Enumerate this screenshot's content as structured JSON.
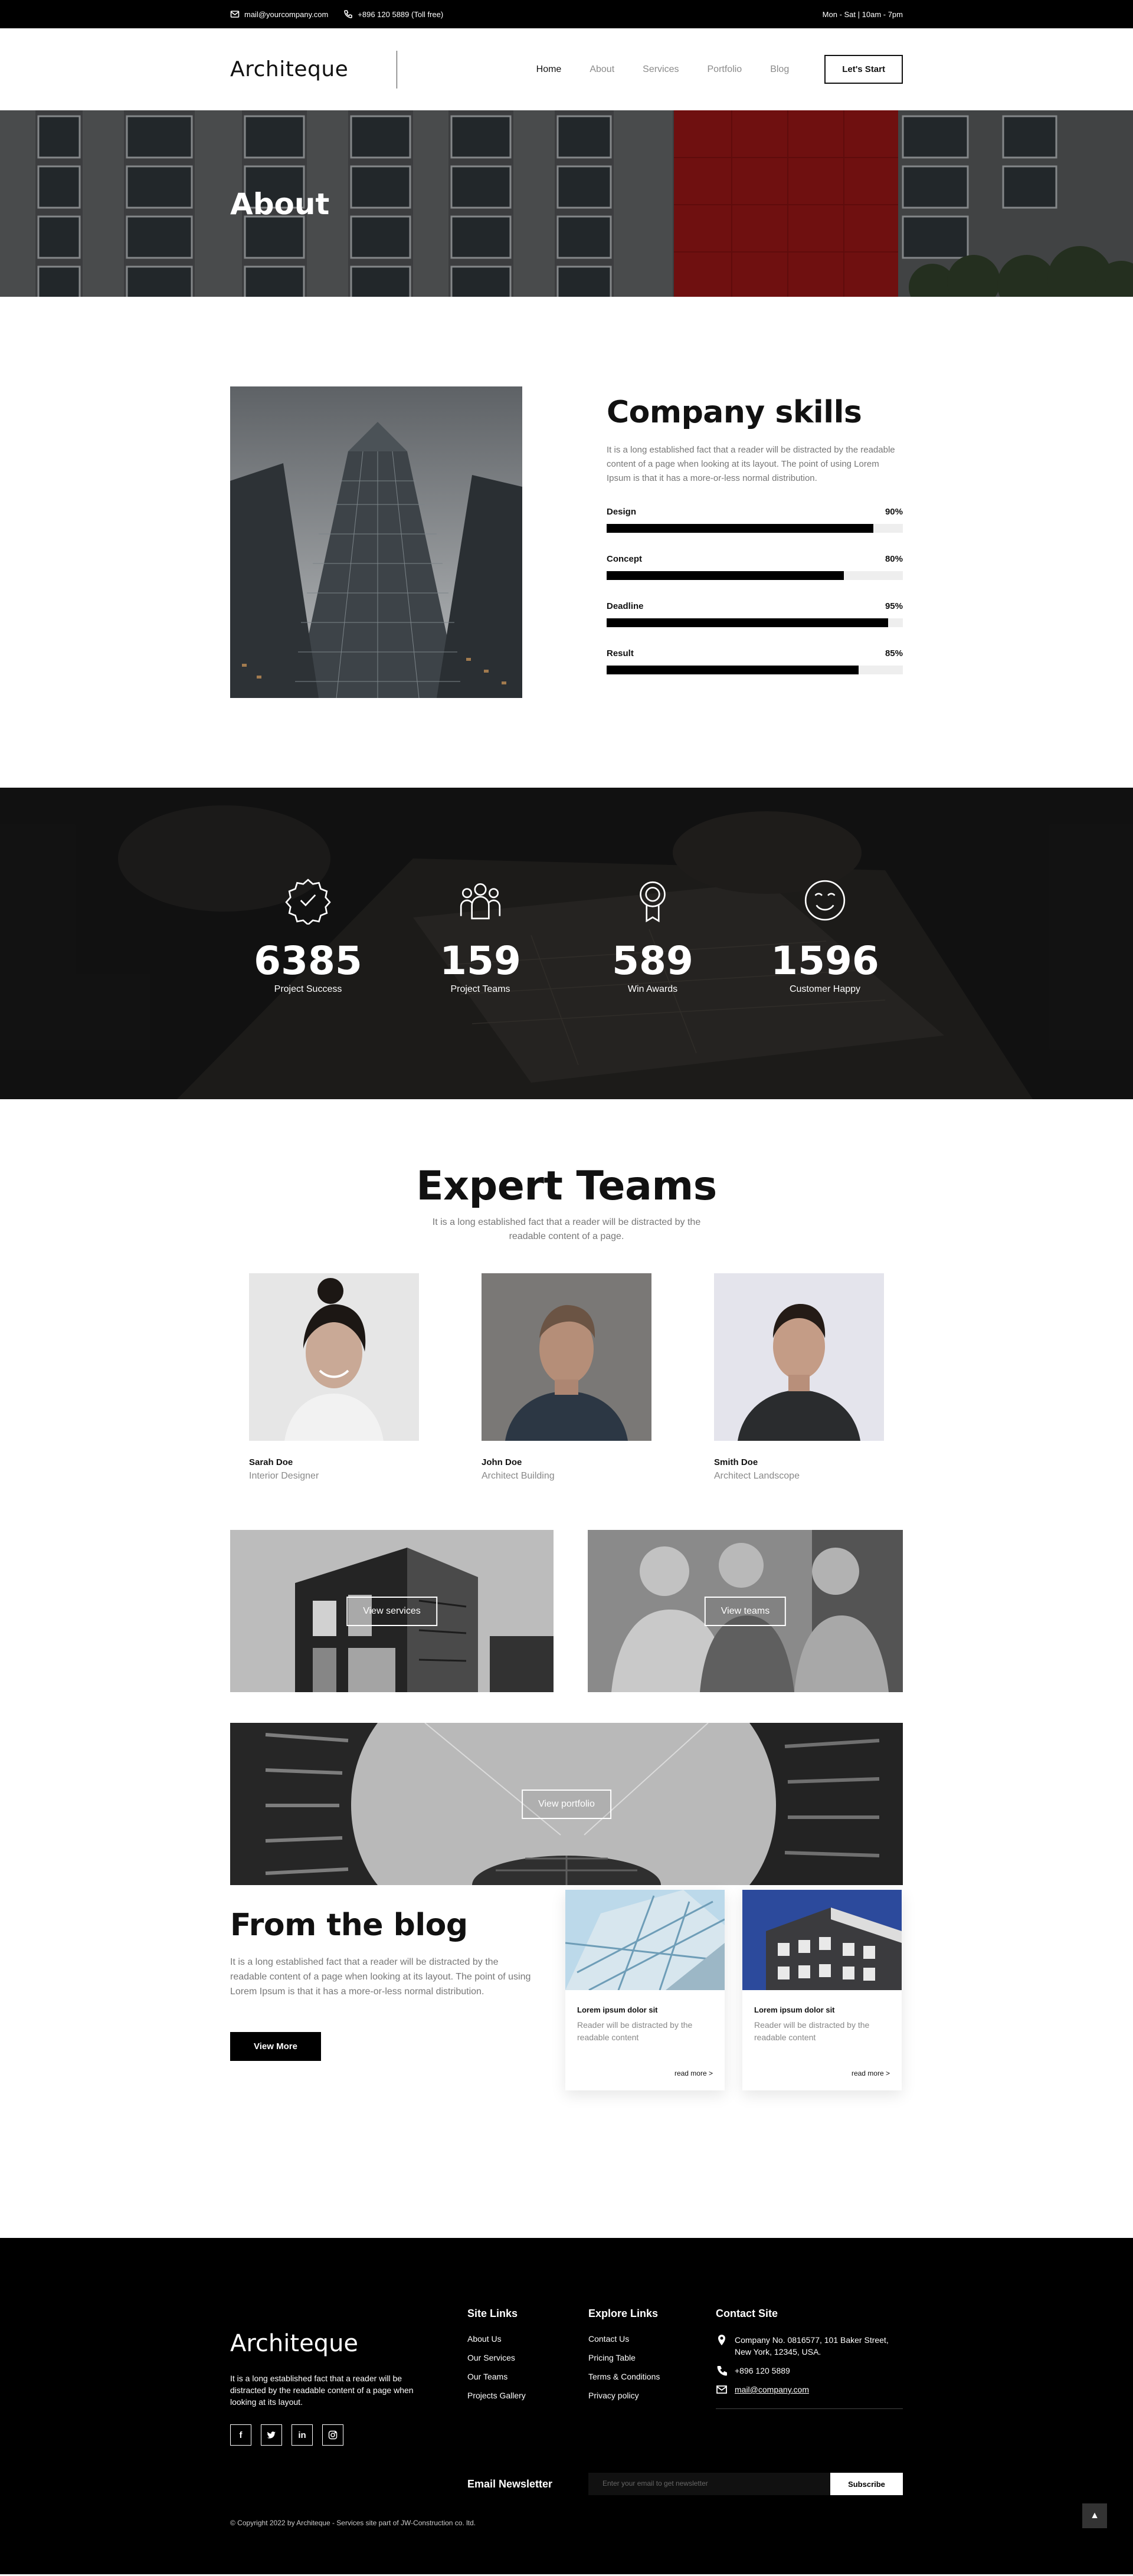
{
  "topbar": {
    "email": "mail@yourcompany.com",
    "phone": "+896 120 5889 (Toll free)",
    "hours": "Mon - Sat | 10am - 7pm"
  },
  "header": {
    "logo": "Architeque",
    "nav": [
      "Home",
      "About",
      "Services",
      "Portfolio",
      "Blog"
    ],
    "cta": "Let's Start"
  },
  "hero": {
    "title": "About"
  },
  "skills": {
    "title": "Company skills",
    "text": "It is a long established fact that a reader will be distracted by the readable content of a page when looking at its layout. The point of using Lorem Ipsum is that it has a more-or-less normal distribution.",
    "items": [
      {
        "label": "Design",
        "value_text": "90%",
        "value": 0.9
      },
      {
        "label": "Concept",
        "value_text": "80%",
        "value": 0.8
      },
      {
        "label": "Deadline",
        "value_text": "95%",
        "value": 0.95
      },
      {
        "label": "Result",
        "value_text": "85%",
        "value": 0.85
      }
    ]
  },
  "stats": [
    {
      "icon": "badge-check-icon",
      "number": "6385",
      "label": "Project Success"
    },
    {
      "icon": "team-icon",
      "number": "159",
      "label": "Project Teams"
    },
    {
      "icon": "award-icon",
      "number": "589",
      "label": "Win Awards"
    },
    {
      "icon": "smile-icon",
      "number": "1596",
      "label": "Customer Happy"
    }
  ],
  "team": {
    "title": "Expert Teams",
    "subtitle": "It is a long established fact that a reader will be distracted by the readable content of a page.",
    "members": [
      {
        "name": "Sarah Doe",
        "role": "Interior Designer"
      },
      {
        "name": "John Doe",
        "role": "Architect Building"
      },
      {
        "name": "Smith Doe",
        "role": "Architect Landscope"
      }
    ]
  },
  "gallery": {
    "services": "View services",
    "teams": "View teams",
    "portfolio": "View portfolio"
  },
  "blog": {
    "title": "From the blog",
    "text": "It is a long established fact that a reader will be distracted by the readable content of a page when looking at its layout. The point of using Lorem Ipsum is that it has a more-or-less normal distribution.",
    "button": "View More",
    "posts": [
      {
        "title": "Lorem ipsum dolor sit",
        "text": "Reader will be distracted by the readable content",
        "more": "read more >"
      },
      {
        "title": "Lorem ipsum dolor sit",
        "text": "Reader will be distracted by the readable content",
        "more": "read more >"
      }
    ]
  },
  "footer": {
    "logo": "Architeque",
    "about": "It is a long established fact that a reader will be distracted by the readable content of a page when looking at its layout.",
    "socials": [
      "f",
      "t",
      "in",
      "ig"
    ],
    "site_links_title": "Site Links",
    "site_links": [
      "About Us",
      "Our Services",
      "Our Teams",
      "Projects Gallery"
    ],
    "explore_title": "Explore Links",
    "explore_links": [
      "Contact Us",
      "Pricing Table",
      "Terms & Conditions",
      "Privacy policy"
    ],
    "contact_title": "Contact Site",
    "address": "Company No. 0816577, 101 Baker Street, New York, 12345, USA.",
    "phone": "+896 120 5889",
    "email": "mail@company.com",
    "newsletter_label": "Email Newsletter",
    "newsletter_placeholder": "Enter your email to get newsletter",
    "subscribe": "Subscribe",
    "copyright": "© Copyright 2022 by Architeque - Services site part of JW-Construction co. ltd.",
    "to_top": "▲"
  }
}
